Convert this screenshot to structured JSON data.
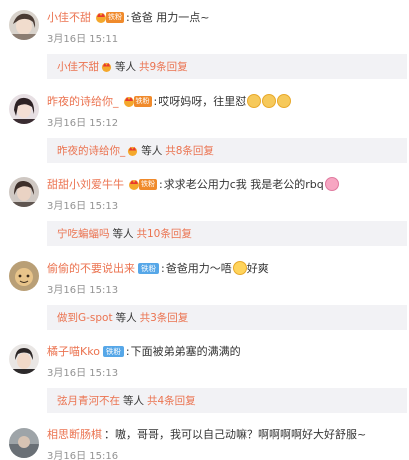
{
  "comments": [
    {
      "username": "小佳不甜",
      "badge": "铁粉",
      "badge_color": "#f08a2b",
      "text": "爸爸 用力一点~",
      "time": "3月16日 15:11",
      "reply": {
        "name": "小佳不甜",
        "etc": "等人",
        "count": "共9条回复",
        "has_crown": true
      }
    },
    {
      "username": "昨夜的诗给你_",
      "badge": "铁粉",
      "badge_color": "#f08a2b",
      "text": "哎呀妈呀，往里怼",
      "time": "3月16日 15:12",
      "reply": {
        "name": "昨夜的诗给你_",
        "etc": "等人",
        "count": "共8条回复",
        "has_crown": true
      }
    },
    {
      "username": "甜甜小刘爱牛牛",
      "badge": "铁粉",
      "badge_color": "#f08a2b",
      "text": "求求老公用力c我 我是老公的rbq",
      "time": "3月16日 15:13",
      "reply": {
        "name": "宁吃蝙蝠吗",
        "etc": "等人",
        "count": "共10条回复",
        "has_crown": false
      }
    },
    {
      "username": "偷偷的不要说出来",
      "badge": "铁粉",
      "badge_color": "#56a7e8",
      "text": "爸爸用力～唔",
      "text2": "好爽",
      "time": "3月16日 15:13",
      "reply": {
        "name": "做到G-spot",
        "etc": "等人",
        "count": "共3条回复",
        "has_crown": false
      }
    },
    {
      "username": "橘子喵Kko",
      "badge": "铁粉",
      "badge_color": "#56a7e8",
      "text": "下面被弟弟塞的满满的",
      "time": "3月16日 15:13",
      "reply": {
        "name": "弦月青河不在",
        "etc": "等人",
        "count": "共4条回复",
        "has_crown": false
      }
    },
    {
      "username": "相思断肠棋",
      "text": "：嗷，哥哥，我可以自己动嘛？啊啊啊啊好大好舒服~",
      "time": "3月16日 15:16"
    }
  ]
}
